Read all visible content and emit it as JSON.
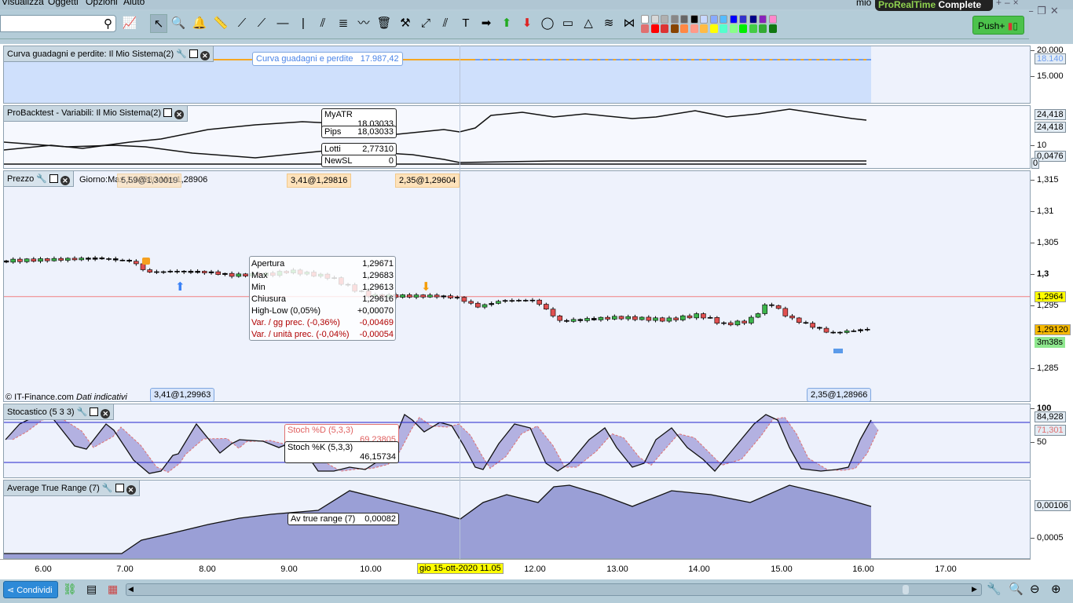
{
  "menu": [
    "Visualizza",
    "Oggetti",
    "Opzioni",
    "Aiuto"
  ],
  "window": {
    "tab": "mio",
    "app_brand_a": "ProRealTime",
    "app_brand_b": "Complete"
  },
  "toolbar": {
    "search_placeholder": "",
    "push_label": "Push+",
    "swatches_top": [
      "#ffffff",
      "#d8d8d8",
      "#b0b0b0",
      "#888888",
      "#666666",
      "#000000",
      "#c8d8ff",
      "#88aaff",
      "#55bbff",
      "#0000ff",
      "#3333cc",
      "#000088",
      "#8822bb",
      "#ff88cc"
    ],
    "swatches_bottom": [
      "#e07070",
      "#ff0000",
      "#dd3333",
      "#884400",
      "#ff8844",
      "#ff9988",
      "#ffbb44",
      "#ffff00",
      "#55ffcc",
      "#88ff88",
      "#00ee00",
      "#44cc44",
      "#33aa33",
      "#117711"
    ]
  },
  "panels": {
    "equity": {
      "title": "Curva guadagni e perdite: Il Mio Sistema(2)",
      "tag_label": "Curva guadagni e perdite",
      "tag_value": "17.987,42",
      "axis": [
        "20.000",
        "15.000"
      ],
      "badge": "18.140"
    },
    "backtest": {
      "title": "ProBacktest - Variabili: Il Mio Sistema(2)",
      "vars": [
        {
          "name": "MyATR",
          "value": "18,03033"
        },
        {
          "name": "Pips",
          "value": "18,03033"
        },
        {
          "name": "Lotti",
          "value": "2,77310"
        },
        {
          "name": "NewSL",
          "value": "0"
        }
      ],
      "axis": [
        "10"
      ],
      "badges": [
        "24,418",
        "24,418",
        "0,0476",
        "0"
      ]
    },
    "price": {
      "title": "Prezzo",
      "info": "Giorno:Max 1,30330 Min 1,28906",
      "order_tags": [
        "5,59@1,30019",
        "3,41@1,29816",
        "2,35@1,29604"
      ],
      "bottom_tags": [
        "3,41@1,29963",
        "2,35@1,28966"
      ],
      "copyright": "© IT-Finance.com",
      "disclaimer": "Dati indicativi",
      "axis": [
        "1,315",
        "1,31",
        "1,305",
        "1,3",
        "1,295",
        "1,285"
      ],
      "badge_level": "1,2964",
      "badge_last": "1,29120",
      "badge_timer": "3m38s",
      "tooltip": [
        {
          "label": "Apertura",
          "value": "1,29671"
        },
        {
          "label": "Max",
          "value": "1,29683"
        },
        {
          "label": "Min",
          "value": "1,29613"
        },
        {
          "label": "Chiusura",
          "value": "1,29616"
        },
        {
          "label": "High-Low (0,05%)",
          "value": "+0,00070"
        },
        {
          "label": "Var. / gg prec. (-0,36%)",
          "value": "-0,00469"
        },
        {
          "label": "Var. / unità prec. (-0,04%)",
          "value": "-0,00054"
        }
      ]
    },
    "stoch": {
      "title": "Stocastico (5 3 3)",
      "d_label": "Stoch %D (5,3,3)",
      "d_value": "69,23805",
      "k_label": "Stoch %K (5,3,3)",
      "k_value": "46,15734",
      "axis": [
        "100",
        "50"
      ],
      "badge_k": "84,928",
      "badge_d": "71,301"
    },
    "atr": {
      "title": "Average True Range (7)",
      "label": "Av true range (7)",
      "value": "0,00082",
      "axis": [
        "0,0005"
      ],
      "badge": "0,00106"
    }
  },
  "xaxis": {
    "labels": [
      "6.00",
      "7.00",
      "8.00",
      "9.00",
      "10.00",
      "12.00",
      "13.00",
      "14.00",
      "15.00",
      "16.00",
      "17.00"
    ],
    "cursor": "gio 15-ott-2020 11.05"
  },
  "bottom": {
    "share_label": "Condividi"
  },
  "colors": {
    "up": "#3cb44b",
    "down": "#e05050",
    "stoch_fill": "#9a9fd6",
    "d_line": "#e07070",
    "equity_fill": "#cfe0fc"
  }
}
